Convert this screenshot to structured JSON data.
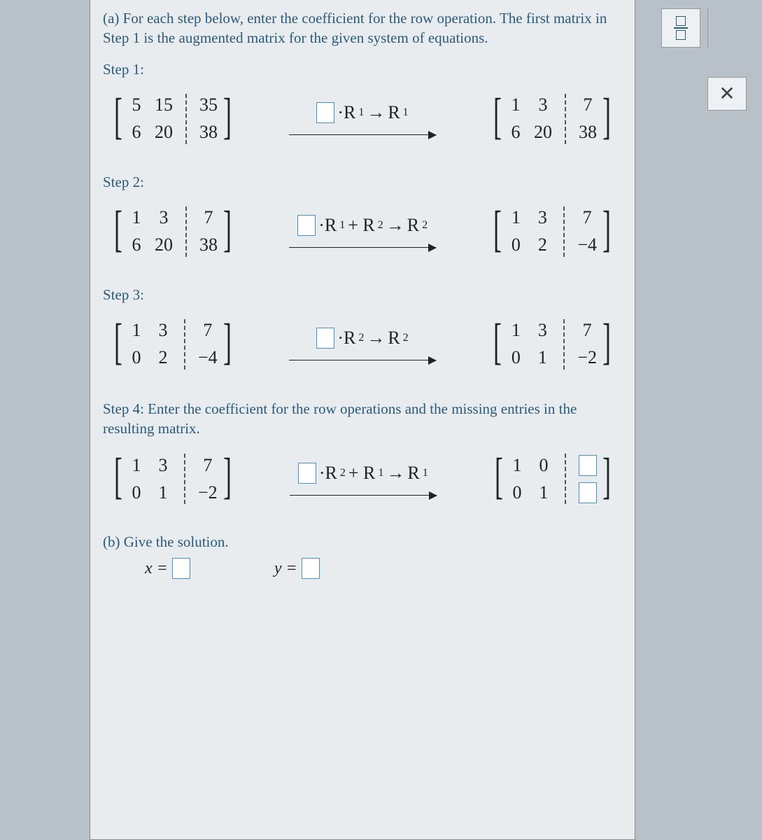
{
  "instructions": "(a) For each step below, enter the coefficient for the row operation. The first matrix in Step 1 is the augmented matrix for the given system of equations.",
  "steps": {
    "s1": {
      "label": "Step 1:",
      "left": {
        "r1c1": "5",
        "r1c2": "15",
        "r1c3": "35",
        "r2c1": "6",
        "r2c2": "20",
        "r2c3": "38"
      },
      "op_mid": "·R",
      "op_sub1": "1",
      "op_arrow": "→",
      "op_r": "R",
      "op_sub2": "1",
      "right": {
        "r1c1": "1",
        "r1c2": "3",
        "r1c3": "7",
        "r2c1": "6",
        "r2c2": "20",
        "r2c3": "38"
      }
    },
    "s2": {
      "label": "Step 2:",
      "left": {
        "r1c1": "1",
        "r1c2": "3",
        "r1c3": "7",
        "r2c1": "6",
        "r2c2": "20",
        "r2c3": "38"
      },
      "op_mid": "·R",
      "op_sub1": "1",
      "op_plus": "+ R",
      "op_sub_plus": "2",
      "op_arrow": "→",
      "op_r": "R",
      "op_sub2": "2",
      "right": {
        "r1c1": "1",
        "r1c2": "3",
        "r1c3": "7",
        "r2c1": "0",
        "r2c2": "2",
        "r2c3": "−4"
      }
    },
    "s3": {
      "label": "Step 3:",
      "left": {
        "r1c1": "1",
        "r1c2": "3",
        "r1c3": "7",
        "r2c1": "0",
        "r2c2": "2",
        "r2c3": "−4"
      },
      "op_mid": "·R",
      "op_sub1": "2",
      "op_arrow": "→",
      "op_r": "R",
      "op_sub2": "2",
      "right": {
        "r1c1": "1",
        "r1c2": "3",
        "r1c3": "7",
        "r2c1": "0",
        "r2c2": "1",
        "r2c3": "−2"
      }
    },
    "s4": {
      "label": "Step 4: Enter the coefficient for the row operations and the missing entries in the resulting matrix.",
      "left": {
        "r1c1": "1",
        "r1c2": "3",
        "r1c3": "7",
        "r2c1": "0",
        "r2c2": "1",
        "r2c3": "−2"
      },
      "op_mid": "·R",
      "op_sub1": "2",
      "op_plus": "+ R",
      "op_sub_plus": "1",
      "op_arrow": "→",
      "op_r": "R",
      "op_sub2": "1",
      "right": {
        "r1c1": "1",
        "r1c2": "0",
        "r2c1": "0",
        "r2c2": "1"
      }
    }
  },
  "partb": {
    "label": "(b) Give the solution.",
    "x": "x =",
    "y": "y ="
  }
}
